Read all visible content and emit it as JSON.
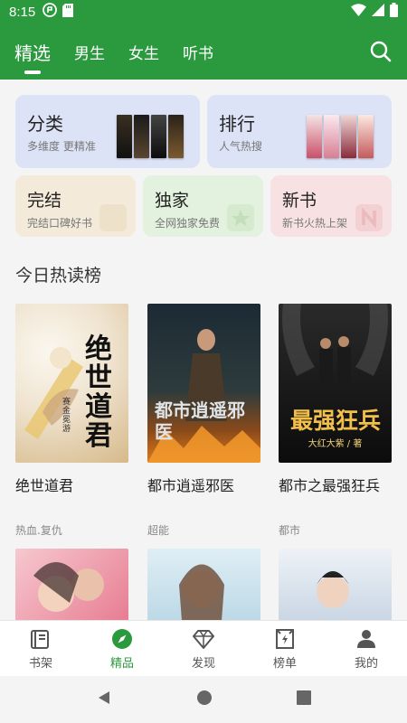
{
  "status_bar": {
    "time": "8:15"
  },
  "top_tabs": [
    {
      "label": "精选",
      "active": true
    },
    {
      "label": "男生"
    },
    {
      "label": "女生"
    },
    {
      "label": "听书"
    }
  ],
  "categories": {
    "classify": {
      "title": "分类",
      "subtitle": "多维度 更精准"
    },
    "ranking": {
      "title": "排行",
      "subtitle": "人气热搜"
    },
    "finished": {
      "title": "完结",
      "subtitle": "完结口碑好书"
    },
    "exclusive": {
      "title": "独家",
      "subtitle": "全网独家免费"
    },
    "new_books": {
      "title": "新书",
      "subtitle": "新书火热上架"
    }
  },
  "section": {
    "title": "今日热读榜"
  },
  "books": [
    {
      "title": "绝世道君",
      "tag": "热血.复仇",
      "cover_text": "绝世道君",
      "cover_author": "赛金冕游"
    },
    {
      "title": "都市逍遥邪医",
      "tag": "超能",
      "cover_text": "都市逍遥邪医"
    },
    {
      "title": "都市之最强狂兵",
      "tag": "都市",
      "cover_text": "最强狂兵",
      "cover_author": "大红大紫 / 著"
    }
  ],
  "bottom_nav": [
    {
      "label": "书架",
      "icon": "bookshelf-icon"
    },
    {
      "label": "精品",
      "icon": "compass-icon",
      "active": true
    },
    {
      "label": "发现",
      "icon": "diamond-icon"
    },
    {
      "label": "榜单",
      "icon": "ranking-icon"
    },
    {
      "label": "我的",
      "icon": "person-icon"
    }
  ],
  "colors": {
    "brand_green": "#2b9a3e",
    "card_blue": "#dde3f6",
    "card_tan": "#f3ead9",
    "card_green": "#e3f2df",
    "card_pink": "#f8e1e2"
  }
}
